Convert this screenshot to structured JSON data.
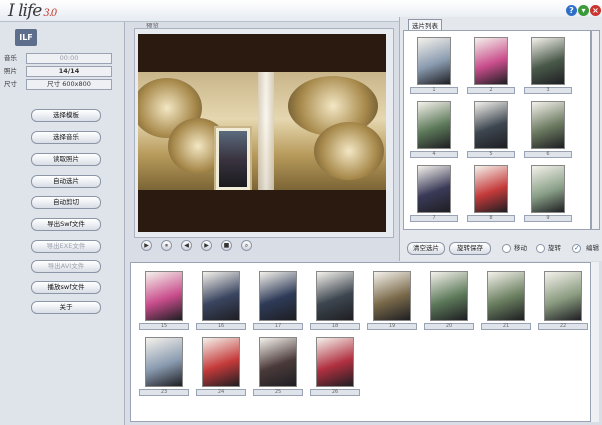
{
  "app": {
    "logo": "I life",
    "version": "3.0"
  },
  "window_buttons": [
    {
      "name": "help-icon",
      "glyph": "?",
      "color": "#2f6fc9"
    },
    {
      "name": "minimize-icon",
      "glyph": "▾",
      "color": "#3a9a3a"
    },
    {
      "name": "close-icon",
      "glyph": "×",
      "color": "#c9352f"
    }
  ],
  "left": {
    "music_label": "音乐",
    "music_value": "00:00",
    "photos_label": "照片",
    "photos_value": "14/14",
    "size_label": "尺寸",
    "size_value": "尺寸 600x800",
    "buttons": [
      {
        "label": "选择模板",
        "enabled": true
      },
      {
        "label": "选择音乐",
        "enabled": true
      },
      {
        "label": "读取照片",
        "enabled": true
      },
      {
        "label": "自动选片",
        "enabled": true
      },
      {
        "label": "自动剪切",
        "enabled": true
      },
      {
        "label": "导出Swf文件",
        "enabled": true
      },
      {
        "label": "导出EXE文件",
        "enabled": false
      },
      {
        "label": "导出AVI文件",
        "enabled": false
      },
      {
        "label": "播放swf文件",
        "enabled": true
      },
      {
        "label": "关于",
        "enabled": true
      }
    ]
  },
  "preview": {
    "label": "预览"
  },
  "controls": [
    "▶",
    "⏸",
    "◀",
    "▶",
    "■",
    "⌕"
  ],
  "selected_list": {
    "label": "选片列表",
    "thumbs": [
      {
        "caption": "1",
        "color": "#8a9bb0"
      },
      {
        "caption": "2",
        "color": "#c94d8c"
      },
      {
        "caption": "3",
        "color": "#4a5a4a"
      },
      {
        "caption": "4",
        "color": "#5d7a5a"
      },
      {
        "caption": "5",
        "color": "#3d4650"
      },
      {
        "caption": "6",
        "color": "#6b7a60"
      },
      {
        "caption": "7",
        "color": "#3a3a58"
      },
      {
        "caption": "8",
        "color": "#c43a3a"
      },
      {
        "caption": "9",
        "color": "#8aa088"
      }
    ]
  },
  "right_buttons": {
    "clear": "清空选片",
    "save": "旋转保存"
  },
  "modes": {
    "move": "移动",
    "rotate": "旋转",
    "edit": "编辑"
  },
  "pool": {
    "thumbs": [
      {
        "caption": "15",
        "color": "#c94d8c"
      },
      {
        "caption": "16",
        "color": "#3a4560"
      },
      {
        "caption": "17",
        "color": "#2e3b58"
      },
      {
        "caption": "18",
        "color": "#3d4650"
      },
      {
        "caption": "19",
        "color": "#7a6a4a"
      },
      {
        "caption": "20",
        "color": "#5d7a5a"
      },
      {
        "caption": "21",
        "color": "#6b8060"
      },
      {
        "caption": "22",
        "color": "#8a9b80"
      },
      {
        "caption": "23",
        "color": "#8a9bb0"
      },
      {
        "caption": "24",
        "color": "#c43a3a"
      },
      {
        "caption": "25",
        "color": "#4a3a3a"
      },
      {
        "caption": "26",
        "color": "#b03040"
      }
    ]
  }
}
